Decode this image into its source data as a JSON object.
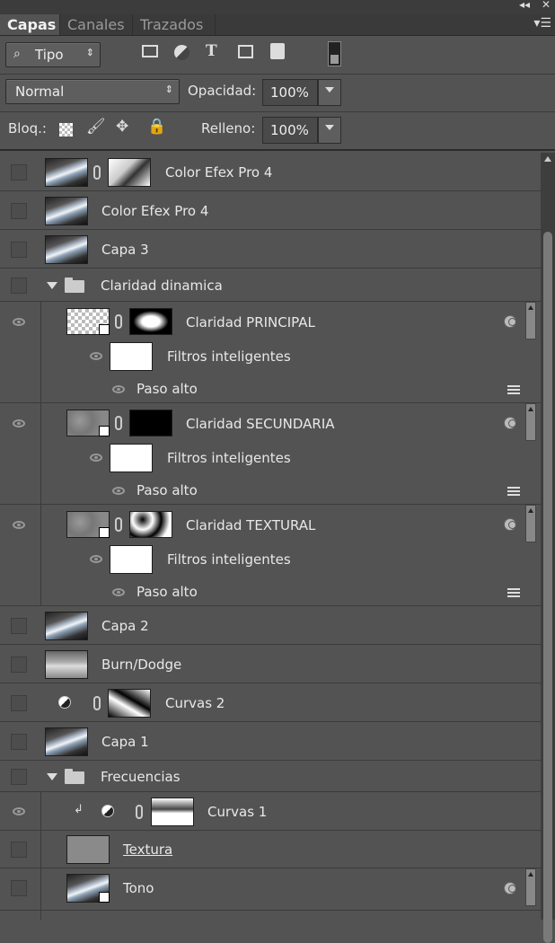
{
  "window": {
    "collapse_icon": "double-chevron-icon",
    "close_icon": "close-icon"
  },
  "tabs": [
    {
      "label": "Capas",
      "active": true
    },
    {
      "label": "Canales",
      "active": false
    },
    {
      "label": "Trazados",
      "active": false
    }
  ],
  "filter": {
    "label": "Tipo",
    "icons": [
      "image-filter-icon",
      "adjustment-filter-icon",
      "type-filter-icon",
      "shape-filter-icon",
      "smart-object-filter-icon"
    ]
  },
  "blend": {
    "mode": "Normal",
    "opacity_label": "Opacidad:",
    "opacity_value": "100%"
  },
  "lock": {
    "label": "Bloq.:",
    "fill_label": "Relleno:",
    "fill_value": "100%"
  },
  "layers": [
    {
      "name": "Color Efex Pro 4",
      "visible": false,
      "thumb": "photo",
      "mask": "mask4"
    },
    {
      "name": "Color Efex Pro 4",
      "visible": false,
      "thumb": "photo"
    },
    {
      "name": "Capa 3",
      "visible": false,
      "thumb": "photo"
    },
    {
      "name": "Claridad dinamica",
      "visible": false,
      "group": true
    },
    {
      "name": "Claridad PRINCIPAL",
      "visible": true,
      "thumb": "check",
      "mask": "mask1",
      "smart_filters": "Filtros inteligentes",
      "filter": "Paso alto"
    },
    {
      "name": "Claridad SECUNDARIA",
      "visible": true,
      "thumb": "grain",
      "mask": "black",
      "smart_filters": "Filtros inteligentes",
      "filter": "Paso alto"
    },
    {
      "name": "Claridad TEXTURAL",
      "visible": true,
      "thumb": "grain",
      "mask": "mask3",
      "smart_filters": "Filtros inteligentes",
      "filter": "Paso alto"
    },
    {
      "name": "Capa 2",
      "visible": false,
      "thumb": "photo"
    },
    {
      "name": "Burn/Dodge",
      "visible": false,
      "thumb": "burn"
    },
    {
      "name": "Curvas 2",
      "visible": false,
      "adjustment": true,
      "mask": "mask5"
    },
    {
      "name": "Capa 1",
      "visible": false,
      "thumb": "photo"
    },
    {
      "name": "Frecuencias",
      "visible": false,
      "group": true
    },
    {
      "name": "Curvas 1",
      "visible": true,
      "adjustment": true,
      "mask": "mask6"
    },
    {
      "name": "Textura",
      "visible": false,
      "thumb": "gray"
    },
    {
      "name": "Tono",
      "visible": false,
      "thumb": "photo"
    }
  ]
}
